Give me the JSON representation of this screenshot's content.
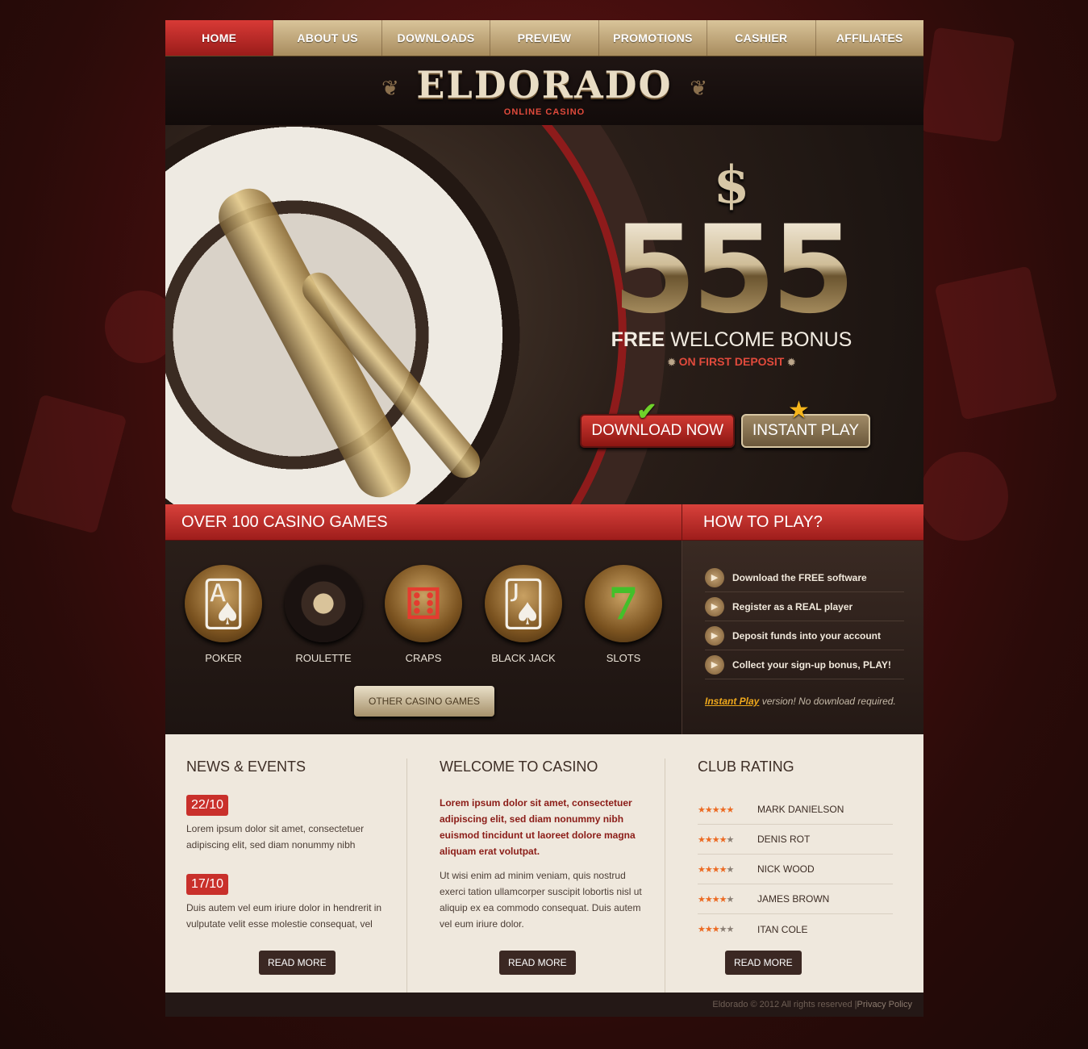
{
  "nav": {
    "items": [
      {
        "label": "HOME",
        "active": true
      },
      {
        "label": "ABOUT US"
      },
      {
        "label": "DOWNLOADS"
      },
      {
        "label": "PREVIEW"
      },
      {
        "label": "PROMOTIONS"
      },
      {
        "label": "CASHIER"
      },
      {
        "label": "AFFILIATES"
      }
    ]
  },
  "logo": {
    "title": "ELDORADO",
    "subtitle": "ONLINE CASINO"
  },
  "hero": {
    "currency": "$",
    "amount": "555",
    "title_bold": "FREE",
    "title_rest": "WELCOME BONUS",
    "subtitle": "ON FIRST DEPOSIT",
    "download_label": "DOWNLOAD NOW",
    "instant_label": "INSTANT PLAY"
  },
  "games": {
    "heading": "OVER 100 CASINO GAMES",
    "items": [
      {
        "label": "POKER",
        "icon": "poker-cards-icon"
      },
      {
        "label": "ROULETTE",
        "icon": "roulette-wheel-icon"
      },
      {
        "label": "CRAPS",
        "icon": "dice-icon"
      },
      {
        "label": "BLACK JACK",
        "icon": "blackjack-cards-icon"
      },
      {
        "label": "SLOTS",
        "icon": "slots-seven-icon"
      }
    ],
    "other_label": "OTHER CASINO GAMES"
  },
  "how": {
    "heading": "HOW TO PLAY?",
    "steps": [
      "Download the FREE software",
      "Register as a REAL player",
      "Deposit funds into your account",
      "Collect your sign-up bonus, PLAY!"
    ],
    "note_link": "Instant Play",
    "note_text": " version! No download required."
  },
  "news": {
    "heading": "NEWS & EVENTS",
    "items": [
      {
        "date": "22/10",
        "text": "Lorem ipsum dolor sit amet, consectetuer adipiscing elit, sed diam nonummy nibh"
      },
      {
        "date": "17/10",
        "text": "Duis autem vel eum iriure dolor in hendrerit in vulputate velit esse molestie consequat, vel"
      }
    ],
    "read_more": "READ MORE"
  },
  "welcome": {
    "heading": "WELCOME TO CASINO",
    "bold_text": "Lorem ipsum dolor sit amet, consectetuer adipiscing elit, sed diam nonummy nibh euismod tincidunt ut laoreet dolore magna aliquam erat volutpat.",
    "text": "Ut wisi enim ad minim veniam, quis nostrud exerci tation ullamcorper suscipit lobortis nisl ut aliquip ex ea commodo consequat. Duis autem vel eum iriure dolor.",
    "read_more": "READ MORE"
  },
  "rating": {
    "heading": "CLUB RATING",
    "items": [
      {
        "name": "MARK DANIELSON",
        "stars": 5
      },
      {
        "name": "DENIS ROT",
        "stars": 4
      },
      {
        "name": "NICK WOOD",
        "stars": 3.5
      },
      {
        "name": "JAMES BROWN",
        "stars": 3.5
      },
      {
        "name": "ITAN COLE",
        "stars": 3
      }
    ],
    "read_more": "READ MORE"
  },
  "footer": {
    "copyright": "Eldorado © 2012 All rights reserved | ",
    "privacy": "Privacy Policy"
  },
  "colors": {
    "accent_red": "#c9302b",
    "gold": "#b89e6d",
    "dark": "#241816"
  }
}
